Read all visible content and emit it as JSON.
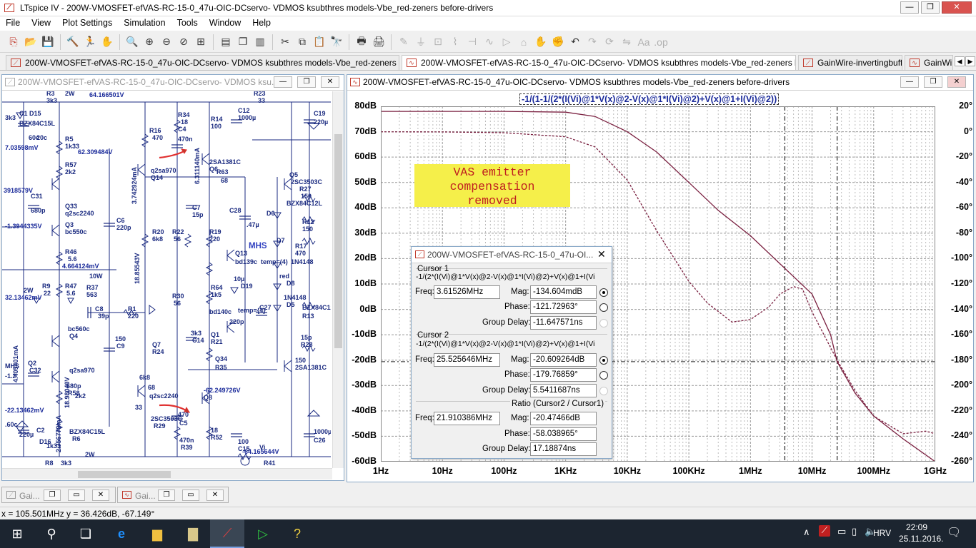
{
  "app": {
    "title": "LTspice IV - 200W-VMOSFET-efVAS-RC-15-0_47u-OIC-DCservo- VDMOS ksubthres models-Vbe_red-zeners before-drivers",
    "menu": [
      "File",
      "View",
      "Plot Settings",
      "Simulation",
      "Tools",
      "Window",
      "Help"
    ]
  },
  "tabs": [
    {
      "label": "200W-VMOSFET-efVAS-RC-15-0_47u-OIC-DCservo- VDMOS ksubthres models-Vbe_red-zeners before-drivers"
    },
    {
      "label": "200W-VMOSFET-efVAS-RC-15-0_47u-OIC-DCservo- VDMOS ksubthres models-Vbe_red-zeners before-drivers"
    },
    {
      "label": "GainWire-invertingbuffer"
    },
    {
      "label": "GainWire"
    }
  ],
  "schematic": {
    "title": "200W-VMOSFET-efVAS-RC-15-0_47u-OIC-DCservo- VDMOS ksu...",
    "labels": [
      "R3",
      "3k3",
      "2W",
      "64.166501V",
      "R23",
      "33",
      "C1",
      "D15",
      "BZX84C15L",
      "R34",
      "18",
      "R14",
      "100",
      "C12",
      "1000µ",
      "C19",
      "220µ",
      "R16",
      "470",
      "C4",
      "470n",
      "6.311140mA",
      "R5",
      "1k33",
      "62.309484V",
      "R57",
      "2k2",
      "3.742924mA",
      "q2sa970",
      "Q14",
      "2SA1381C",
      "Q6",
      "R63",
      "68",
      "Q5",
      "2SC3503C",
      "R27",
      "150",
      "BZX84C12L",
      "Q33",
      "q2sc2240",
      "C31",
      "680p",
      "3918579V",
      "Q3",
      "bc550c",
      "C6",
      "220p",
      "18.85543V",
      "R20",
      "6k8",
      "C7",
      "15p",
      "R22",
      "56",
      "R19",
      "220",
      "C28",
      ".47µ",
      "D6",
      "R12",
      "150",
      "R46",
      "5.6",
      "R9",
      "22",
      "2W",
      "4.664124mV",
      "R47",
      "5.6",
      "R37",
      "563",
      "10W",
      "Q13",
      "bd139c",
      "temp=(4)",
      "D7",
      "R17",
      "470",
      "1N4148",
      "C8",
      "39p",
      "R1",
      "220",
      "bc560c",
      "Q4",
      "R30",
      "56",
      "R64",
      "1k5",
      "bd140c",
      "temp={4}",
      "C27",
      "10µ",
      "D19",
      "red",
      "D8",
      "1N4148",
      "D5",
      "BZX84C12L",
      "R13",
      "150",
      "C9",
      "220p",
      "Q1",
      "R21",
      "3k3",
      "C14",
      "15p",
      "R28",
      "150",
      "2SA1381C",
      "Q7",
      "R24",
      "6k8",
      "18.98049V",
      "q2sa970",
      "Q34",
      "R35",
      "68",
      "q2sc2240",
      "Q2",
      "C32",
      "680p",
      "R58",
      "2k2",
      "-62.249726V",
      "Q8",
      "2SC3503C",
      "R29",
      "470",
      "C5",
      "470n",
      "R39",
      "18",
      "R52",
      "100",
      "C15",
      "1000µ",
      "C26",
      "220µ",
      "C2",
      "D16",
      "BZX84C15L",
      "R6",
      "1k33",
      "R8",
      "3k3",
      "2W",
      "-64.165644V",
      "Vi",
      "R41",
      "33",
      "2.756779mA",
      "4.405401mA",
      "MHS",
      "-22.13462mV",
      "-1.3944335V",
      "32.13462mV",
      "7.03598mV",
      "3k3",
      "-1.2",
      ".60c",
      "60c",
      "20c"
    ]
  },
  "plot": {
    "title": "200W-VMOSFET-efVAS-RC-15-0_47u-OIC-DCservo- VDMOS ksubthres models-Vbe_red-zeners before-drivers",
    "trace_label": "-1/(1-1/(2*(I(Vi)@1*V(x)@2-V(x)@1*I(Vi)@2)+V(x)@1+I(Vi)@2))",
    "note": "VAS emitter\ncompensation\nremoved",
    "trace_color": "#7a2040"
  },
  "chart_data": {
    "type": "line",
    "xscale": "log",
    "x_ticks": [
      "1Hz",
      "10Hz",
      "100Hz",
      "1KHz",
      "10KHz",
      "100KHz",
      "1MHz",
      "10MHz",
      "100MHz",
      "1GHz"
    ],
    "y_left_ticks": [
      "80dB",
      "70dB",
      "60dB",
      "50dB",
      "40dB",
      "30dB",
      "20dB",
      "10dB",
      "0dB",
      "-10dB",
      "-20dB",
      "-30dB",
      "-40dB",
      "-50dB",
      "-60dB"
    ],
    "y_right_ticks": [
      "20°",
      "0°",
      "-20°",
      "-40°",
      "-60°",
      "-80°",
      "-100°",
      "-120°",
      "-140°",
      "-160°",
      "-180°",
      "-200°",
      "-220°",
      "-240°",
      "-260°"
    ],
    "xlim_hz": [
      1,
      1000000000
    ],
    "ylim_db": [
      -60,
      80
    ],
    "ylim_deg": [
      -260,
      20
    ],
    "grid": true,
    "series": [
      {
        "style": "solid",
        "axis": "magnitude",
        "x": [
          1,
          10,
          100,
          1000,
          3000,
          10000,
          30000,
          100000,
          300000,
          1000000,
          3000000,
          10000000,
          20000000,
          25500000,
          50000000,
          100000000,
          300000000,
          1000000000
        ],
        "y": [
          78,
          78,
          78,
          77.7,
          76,
          70,
          62,
          50,
          39,
          29,
          18,
          6,
          -10,
          -20.6,
          -33,
          -42,
          -51,
          -60
        ]
      },
      {
        "style": "dashed",
        "axis": "phase",
        "x": [
          1,
          10,
          100,
          1000,
          3000,
          10000,
          30000,
          100000,
          200000,
          500000,
          1000000,
          2000000,
          3000000,
          5000000,
          7000000,
          10000000,
          25500000,
          50000000,
          100000000,
          300000000,
          700000000,
          1000000000
        ],
        "y": [
          -0.1,
          -0.2,
          -0.8,
          -4,
          -12,
          -38,
          -78,
          -118,
          -135,
          -150,
          -148,
          -138,
          -128,
          -122,
          -124,
          -142,
          -180,
          -204,
          -224,
          -238,
          -236,
          -238
        ]
      }
    ],
    "cursors": [
      {
        "x_hz": 3615260,
        "style": "dash-dot"
      },
      {
        "x_hz": 25525646,
        "style": "dash-dot"
      }
    ]
  },
  "cursor_dialog": {
    "title": "200W-VMOSFET-efVAS-RC-15-0_47u-OI...",
    "cursor1": {
      "heading": "Cursor 1",
      "expr": "-1/(2*(I(Vi)@1*V(x)@2-V(x)@1*I(Vi)@2)+V(x)@1+I(Vi)",
      "freq_label": "Freq:",
      "freq": "3.61526MHz",
      "mag_label": "Mag:",
      "mag": "-134.604mdB",
      "phase_label": "Phase:",
      "phase": "-121.72963°",
      "gd_label": "Group Delay:",
      "gd": "-11.647571ns"
    },
    "cursor2": {
      "heading": "Cursor 2",
      "expr": "-1/(2*(I(Vi)@1*V(x)@2-V(x)@1*I(Vi)@2)+V(x)@1+I(Vi)",
      "freq_label": "Freq:",
      "freq": "25.525646MHz",
      "mag_label": "Mag:",
      "mag": "-20.609264dB",
      "phase_label": "Phase:",
      "phase": "-179.76859°",
      "gd_label": "Group Delay:",
      "gd": "5.5411687ns"
    },
    "ratio": {
      "heading": "Ratio (Cursor2 / Cursor1)",
      "freq_label": "Freq:",
      "freq": "21.910386MHz",
      "mag_label": "Mag:",
      "mag": "-20.47466dB",
      "phase_label": "Phase:",
      "phase": "-58.038965°",
      "gd_label": "Group Delay:",
      "gd": "17.18874ns"
    }
  },
  "minimized": [
    {
      "label": "Gai..."
    },
    {
      "label": "Gai..."
    }
  ],
  "status": {
    "text": "x = 105.501MHz   y = 36.426dB, -67.149°"
  },
  "taskbar": {
    "lang": "HRV",
    "time": "22:09",
    "date": "25.11.2016."
  }
}
